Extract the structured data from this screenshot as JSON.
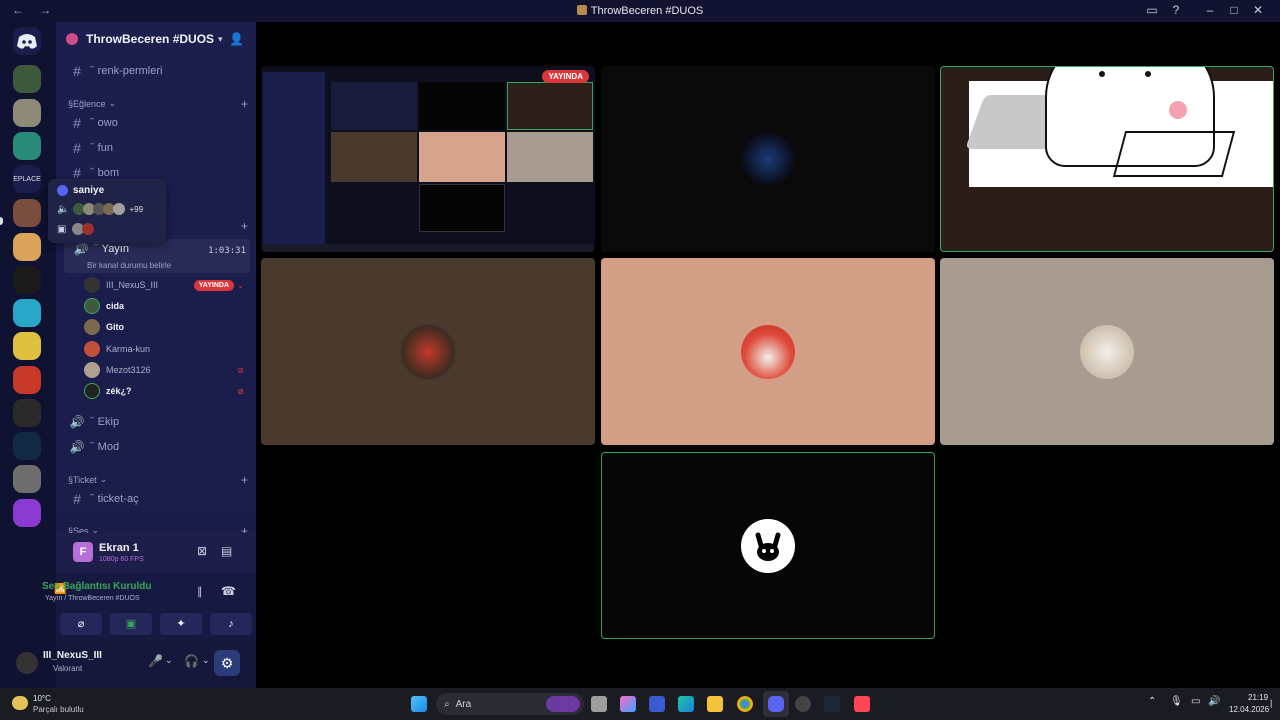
{
  "window": {
    "title": "ThrowBeceren #DUOS"
  },
  "guild": {
    "name": "ThrowBeceren #DUOS"
  },
  "channels": {
    "top": {
      "name": "renk-permleri"
    },
    "categories": [
      {
        "name": "Eğlence",
        "items": [
          "owo",
          "fun",
          "bom"
        ]
      },
      {
        "name": "Ticket",
        "items": [
          "ticket-aç"
        ]
      },
      {
        "name": "Ses"
      }
    ],
    "voice_active": {
      "name": "Yayın",
      "timer": "1:03:31",
      "status": "Bir kanal durumu belirle"
    },
    "voice_users": [
      {
        "name": "III_NexuS_III",
        "live": "YAYINDA"
      },
      {
        "name": "cida"
      },
      {
        "name": "Gito"
      },
      {
        "name": "Karma-kun"
      },
      {
        "name": "Mezot3126"
      },
      {
        "name": "zék¿?"
      }
    ],
    "voice_other": [
      "Ekip",
      "Mod"
    ]
  },
  "popup": {
    "name": "saniye",
    "more": "+99"
  },
  "panel": {
    "screen": {
      "title": "Ekran 1",
      "sub": "1080p 60 FPS"
    },
    "voice": {
      "title": "Ses Bağlantısı Kuruldu",
      "sub": "Yayın / ThrowBeceren #DUOS"
    },
    "user": {
      "name": "III_NexuS_III",
      "status": "Valorant"
    }
  },
  "stage": {
    "live_badge": "YAYINDA"
  },
  "taskbar": {
    "weather_temp": "10°C",
    "weather_desc": "Parçalı bulutlu",
    "search": "Ara",
    "time": "21:19",
    "date": "12.04.2026"
  },
  "colors": {
    "accent": "#5865f2",
    "live": "#da373c",
    "speaking": "#3ba55c"
  }
}
